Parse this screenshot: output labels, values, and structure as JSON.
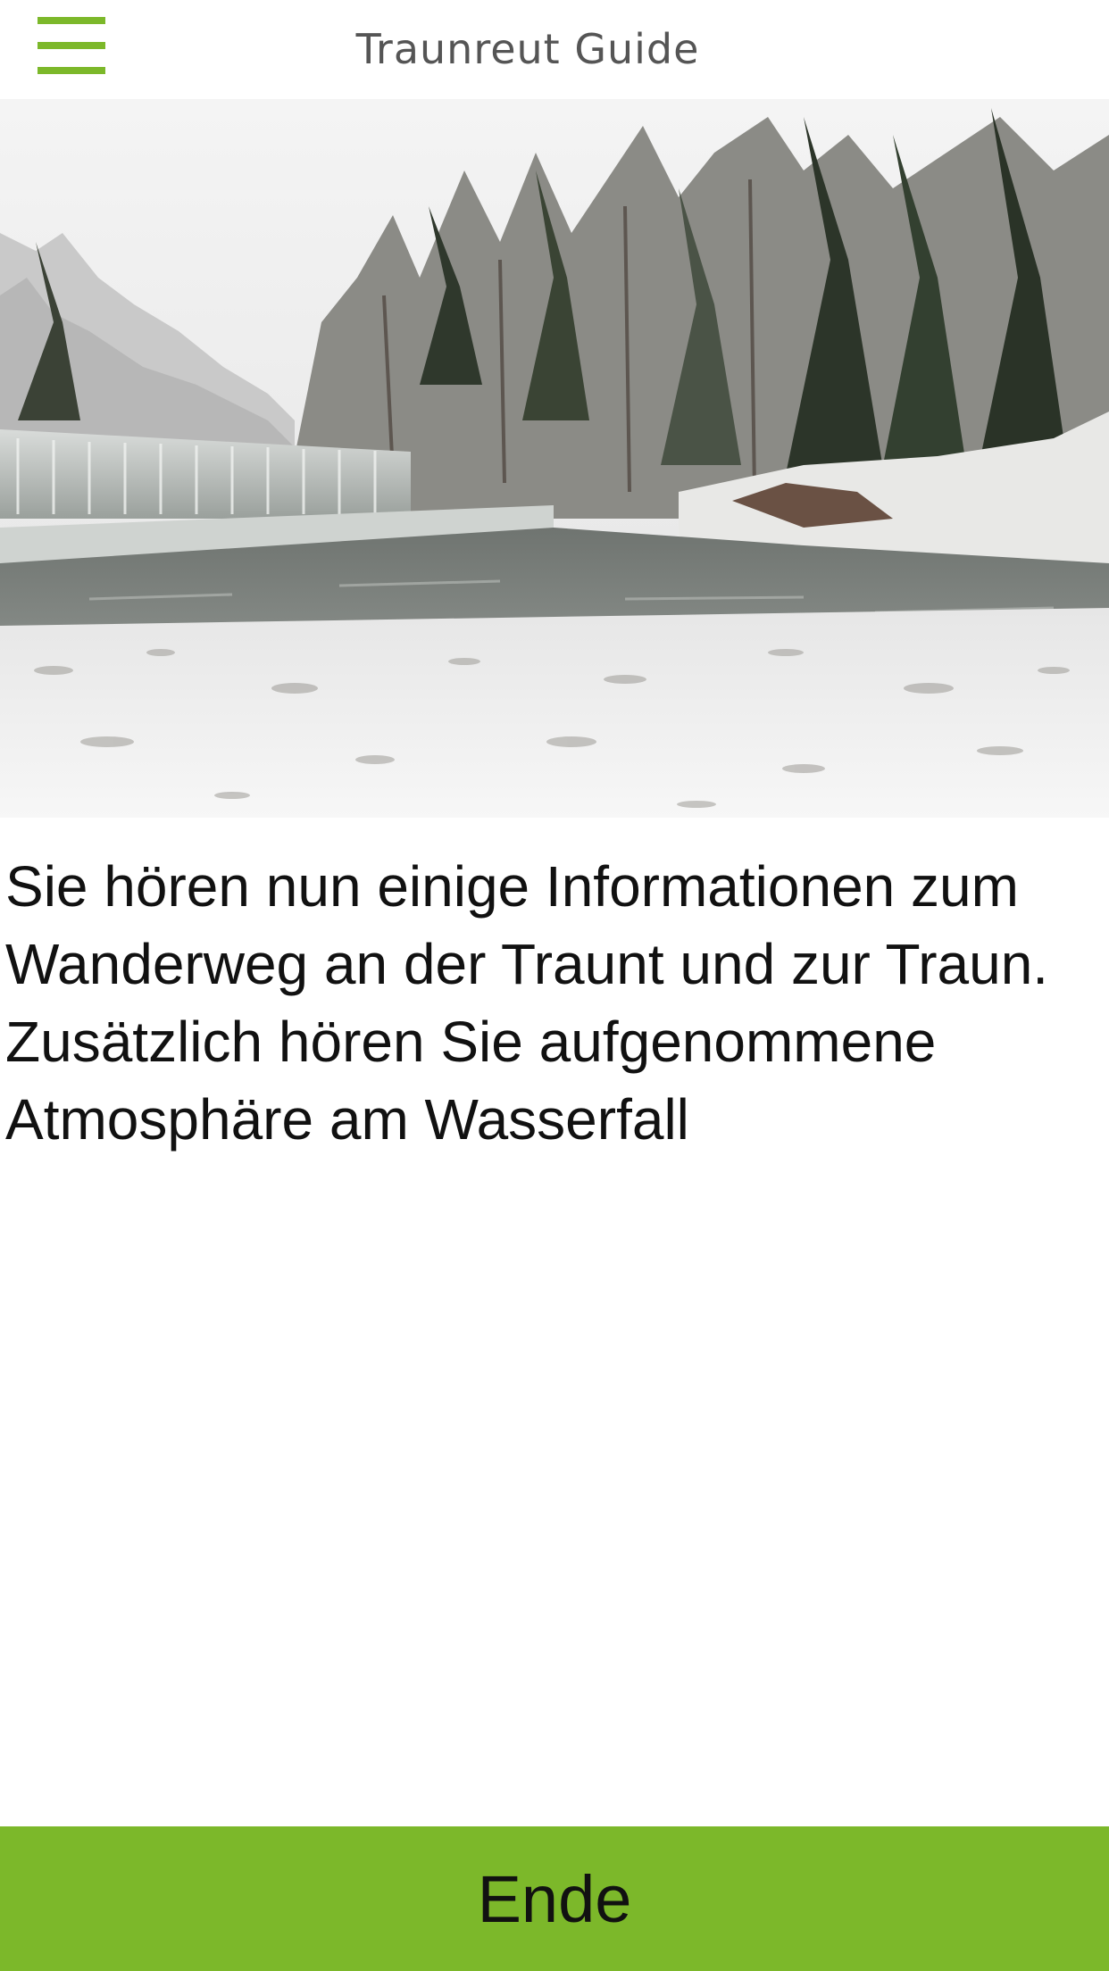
{
  "header": {
    "title": "Traunreut Guide",
    "menu_icon": "hamburger-menu-icon"
  },
  "hero": {
    "image": "snowy-river-weir-landscape"
  },
  "content": {
    "description": "Sie hören nun einige Informationen zum Wanderweg an der Traunt und zur Traun. Zusätzlich hören Sie aufgenommene Atmosphäre am Wasserfall"
  },
  "footer": {
    "end_label": "Ende"
  },
  "colors": {
    "accent": "#7cb82a",
    "title_text": "#555555",
    "body_text": "#111111",
    "background": "#ffffff"
  }
}
